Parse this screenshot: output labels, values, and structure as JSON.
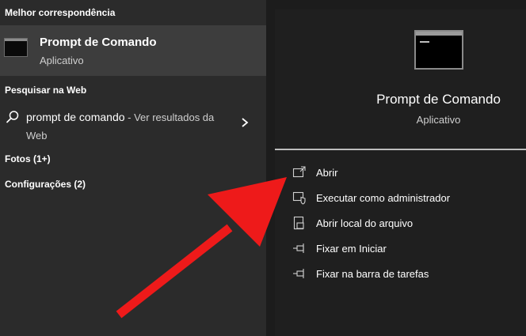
{
  "left": {
    "best_match_heading": "Melhor correspondência",
    "best_match": {
      "title": "Prompt de Comando",
      "subtitle": "Aplicativo",
      "icon": "terminal-icon"
    },
    "web_heading": "Pesquisar na Web",
    "web_result": {
      "query": "prompt de comando",
      "hint": " - Ver resultados da Web",
      "icon": "search-icon"
    },
    "photos_heading": "Fotos (1+)",
    "settings_heading": "Configurações (2)"
  },
  "detail": {
    "title": "Prompt de Comando",
    "subtitle": "Aplicativo",
    "actions": [
      {
        "label": "Abrir",
        "icon": "open-icon"
      },
      {
        "label": "Executar como administrador",
        "icon": "run-as-admin-icon"
      },
      {
        "label": "Abrir local do arquivo",
        "icon": "file-location-icon"
      },
      {
        "label": "Fixar em Iniciar",
        "icon": "pin-icon"
      },
      {
        "label": "Fixar na barra de tarefas",
        "icon": "pin-taskbar-icon"
      }
    ]
  },
  "annotation": {
    "arrow_color": "#ee1a1a"
  }
}
